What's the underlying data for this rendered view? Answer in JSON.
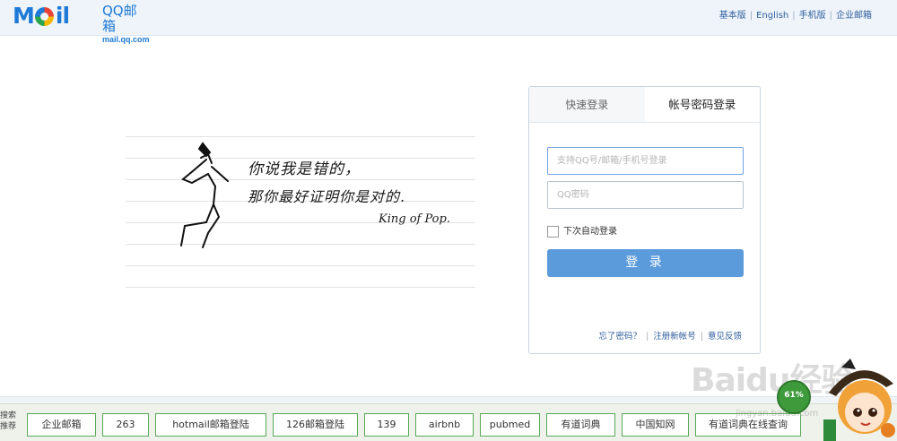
{
  "header": {
    "logo_text": "Mail",
    "logo_cn": "QQ邮箱",
    "logo_url": "mail.qq.com",
    "links": [
      "基本版",
      "English",
      "手机版",
      "企业邮箱"
    ]
  },
  "sketch": {
    "line1": "你说我是错的，",
    "line2": "那你最好证明你是对的.",
    "signature": "King of Pop."
  },
  "login": {
    "tabs": [
      "快速登录",
      "帐号密码登录"
    ],
    "username_placeholder": "支持QQ号/邮箱/手机号登录",
    "password_placeholder": "QQ密码",
    "remember_label": "下次自动登录",
    "login_button": "登 录",
    "links": [
      "忘了密码？",
      "注册新帐号",
      "意见反馈"
    ]
  },
  "footer": {
    "search_label": "搜索\n推荐",
    "chips": [
      "企业邮箱",
      "263",
      "hotmail邮箱登陆",
      "126邮箱登陆",
      "139",
      "airbnb",
      "pubmed",
      "有道词典",
      "中国知网",
      "有道词典在线查询"
    ]
  },
  "watermark": {
    "brand": "Baidu经验",
    "url": "jingyan.baidu.com",
    "badge": "61%"
  },
  "colors": {
    "brand_blue": "#1e7ad6",
    "login_button": "#5b9bdc",
    "chip_border": "#57a957"
  }
}
